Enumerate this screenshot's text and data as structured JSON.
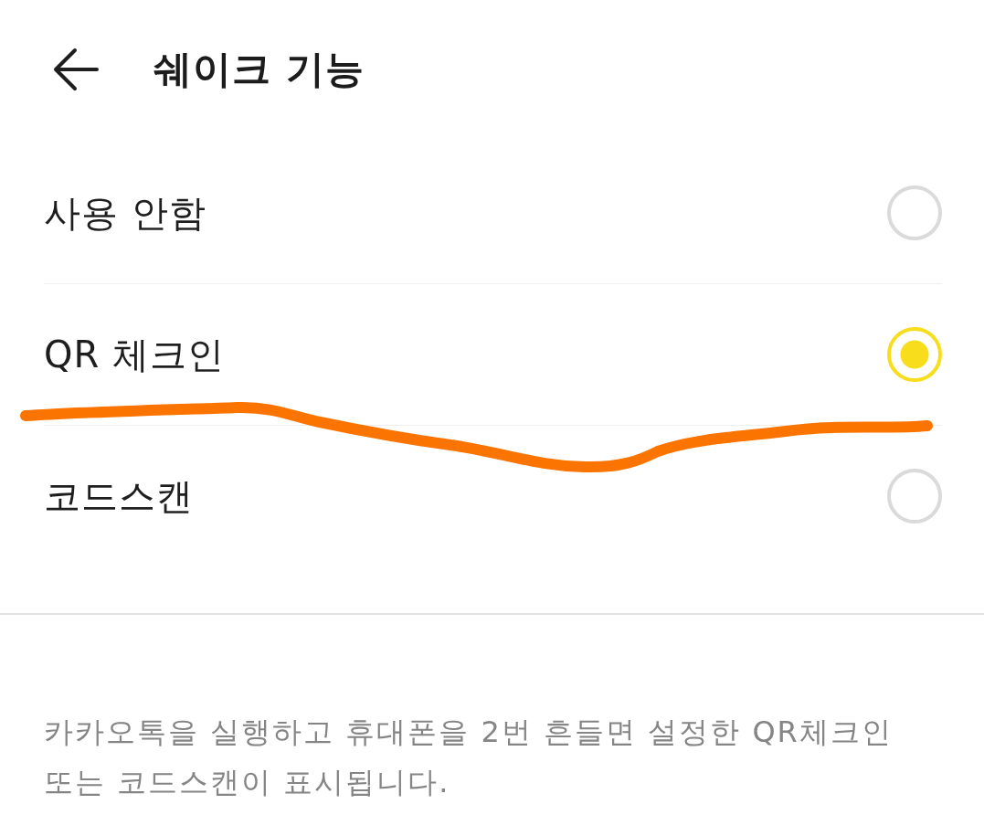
{
  "header": {
    "title": "쉐이크 기능"
  },
  "options": [
    {
      "label": "사용 안함",
      "selected": false
    },
    {
      "label": "QR 체크인",
      "selected": true
    },
    {
      "label": "코드스캔",
      "selected": false
    }
  ],
  "description": "카카오톡을 실행하고 휴대폰을 2번 흔들면 설정한 QR체크인 또는 코드스캔이 표시됩니다.",
  "annotation": {
    "kind": "freehand-stroke"
  }
}
